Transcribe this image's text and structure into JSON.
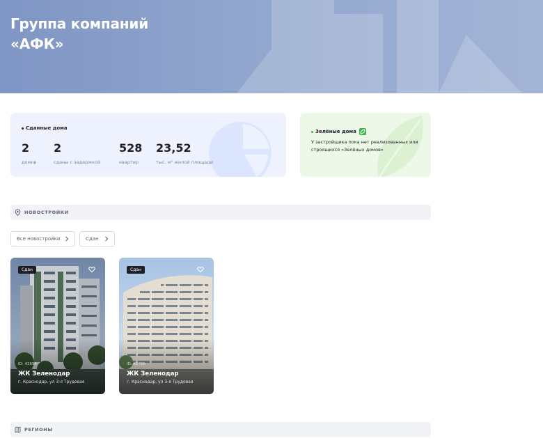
{
  "hero": {
    "title_line1": "Группа компаний",
    "title_line2": "«АФК»"
  },
  "stats": {
    "label": "Сданные дома",
    "items": [
      {
        "value": "2",
        "caption": "домов"
      },
      {
        "value": "2",
        "caption": "сданы с задержкой"
      },
      {
        "value": "528",
        "caption": "квартир"
      },
      {
        "value": "23,52",
        "caption": "тыс. м² жилой площади"
      }
    ]
  },
  "green": {
    "label": "Зелёные дома",
    "badge_icon": "leaf-icon",
    "text": "У застройщика пока нет реализованных или строящихся «Зелёных домов»"
  },
  "sections": {
    "new_buildings": "НОВОСТРОЙКИ",
    "regions": "РЕГИОНЫ"
  },
  "filters": [
    {
      "label": "Все новостройки"
    },
    {
      "label": "Сдан"
    }
  ],
  "projects": [
    {
      "status": "Сдан",
      "id": "ID: 42694",
      "name": "ЖК Зеленодар",
      "address": "г. Краснодар, ул 3-я Трудовая"
    },
    {
      "status": "Сдан",
      "id": "ID: 41726",
      "name": "ЖК Зеленодар",
      "address": "г. Краснодар, ул 3-я Трудовая"
    }
  ],
  "colors": {
    "hero_bg": "#8ea2cb",
    "stats_bg": "#edf2fe",
    "green_bg": "#eef8e9",
    "accent_green": "#3cb54a"
  }
}
